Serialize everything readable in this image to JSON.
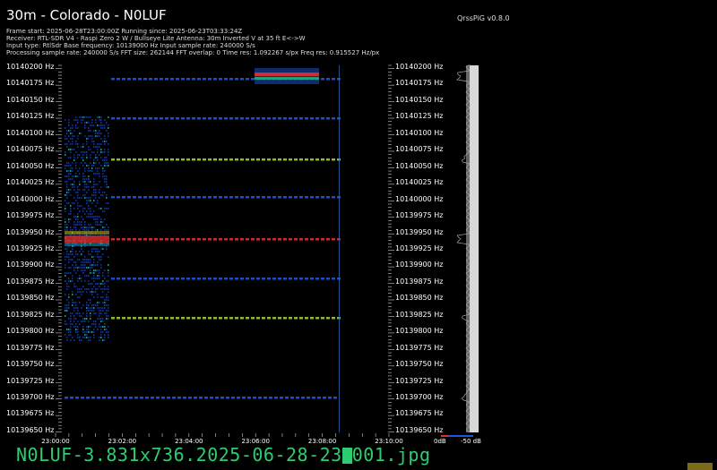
{
  "header": {
    "title": "30m - Colorado - N0LUF",
    "version": "QrssPiG v0.8.0",
    "info_lines": [
      "Frame start: 2025-06-28T23:00:00Z Running since: 2025-06-23T03:33:24Z",
      "Receiver: RTL-SDR V4 - Raspi Zero 2 W / Bullseye Lite Antenna: 30m Inverted V at 35 ft E<->W",
      "Input type: RtlSdr Base frequency: 10139000 Hz Input sample rate: 240000 S/s",
      "Processing sample rate: 240000 S/s FFT size: 262144 FFT overlap: 0 Time res: 1.092267 s/px Freq res: 0.915527 Hz/px"
    ]
  },
  "frequency_labels": [
    "10140200 Hz",
    "10140175 Hz",
    "10140150 Hz",
    "10140125 Hz",
    "10140100 Hz",
    "10140075 Hz",
    "10140050 Hz",
    "10140025 Hz",
    "10140000 Hz",
    "10139975 Hz",
    "10139950 Hz",
    "10139925 Hz",
    "10139900 Hz",
    "10139875 Hz",
    "10139850 Hz",
    "10139825 Hz",
    "10139800 Hz",
    "10139775 Hz",
    "10139750 Hz",
    "10139725 Hz",
    "10139700 Hz",
    "10139675 Hz",
    "10139650 Hz"
  ],
  "time_labels": [
    "23:00:00",
    "23:02:00",
    "23:04:00",
    "23:06:00",
    "23:08:00",
    "23:10:00"
  ],
  "spectrum_scale": {
    "min_label": "0dB",
    "max_label": "-50 dB"
  },
  "footer": {
    "filename_before": "N0LUF-3.831x736.2025-06-28-23",
    "filename_after": "001.jpg"
  },
  "colors": {
    "signal_blue": "#2255dd",
    "signal_green": "#9acd32",
    "signal_red": "#e03030",
    "filename_green": "#2ecc71"
  }
}
